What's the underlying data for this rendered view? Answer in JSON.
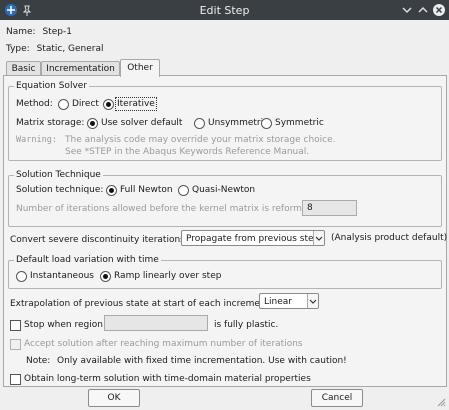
{
  "window": {
    "title": "Edit Step",
    "name_label": "Name:",
    "name_value": "Step-1",
    "type_label": "Type:",
    "type_value": "Static, General"
  },
  "tabs": [
    {
      "label": "Basic"
    },
    {
      "label": "Incrementation"
    },
    {
      "label": "Other",
      "active": true
    }
  ],
  "equation_solver": {
    "title": "Equation Solver",
    "method_label": "Method:",
    "methods": [
      "Direct",
      "Iterative"
    ],
    "method_selected": "Iterative",
    "storage_label": "Matrix storage:",
    "storage_options": [
      "Use solver default",
      "Unsymmetric",
      "Symmetric"
    ],
    "storage_selected": "Use solver default",
    "warning_label": "Warning:",
    "warning_line1": "The analysis code may override your matrix storage choice.",
    "warning_line2": "See *STEP in the Abaqus Keywords Reference Manual."
  },
  "solution_technique": {
    "title": "Solution Technique",
    "label": "Solution technique:",
    "options": [
      "Full Newton",
      "Quasi-Newton"
    ],
    "selected": "Full Newton",
    "iterations_label": "Number of iterations allowed before the kernel matrix is reformed:",
    "iterations_value": "8"
  },
  "discontinuity": {
    "label": "Convert severe discontinuity iterations:",
    "value": "Propagate from previous step",
    "note": "(Analysis product default)"
  },
  "load_variation": {
    "title": "Default load variation with time",
    "options": [
      "Instantaneous",
      "Ramp linearly over step"
    ],
    "selected": "Ramp linearly over step"
  },
  "extrapolation": {
    "label": "Extrapolation of previous state at start of each increment:",
    "value": "Linear"
  },
  "stop_region": {
    "label": "Stop when region",
    "suffix": "is fully plastic.",
    "checked": false
  },
  "accept_solution": {
    "label": "Accept solution after reaching maximum number of iterations",
    "checked": false,
    "enabled": false
  },
  "note": {
    "label": "Note:",
    "text": "Only available with fixed time incrementation. Use with caution!"
  },
  "long_term": {
    "label": "Obtain long-term solution with time-domain material properties",
    "checked": false
  },
  "buttons": {
    "ok": "OK",
    "cancel": "Cancel"
  },
  "colors": {
    "titlebar": "#3a3f44",
    "dialog_bg": "#efefef"
  }
}
